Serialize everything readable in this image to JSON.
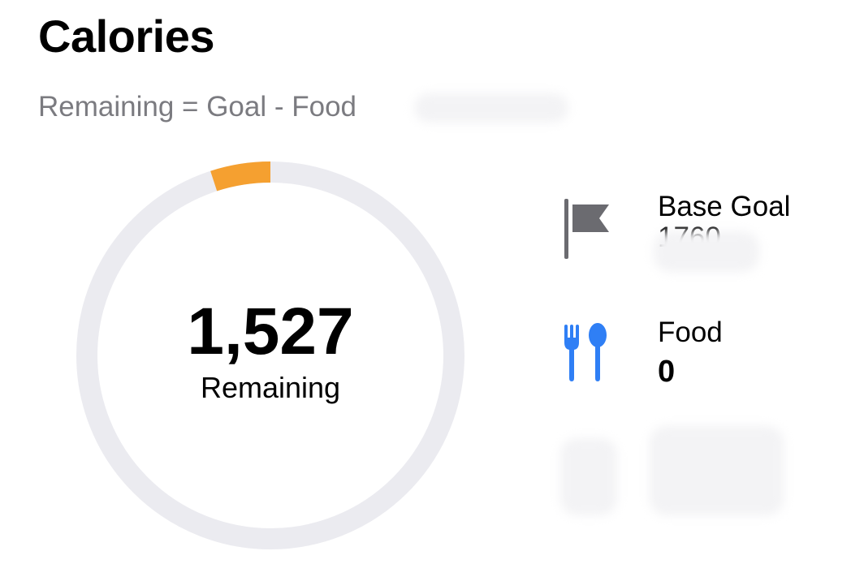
{
  "header": {
    "title": "Calories",
    "formula": "Remaining = Goal - Food"
  },
  "ring": {
    "value": "1,527",
    "label": "Remaining",
    "consumed_fraction": 0.05,
    "track_color": "#ebebf0",
    "progress_color": "#f5a030"
  },
  "stats": [
    {
      "icon": "flag-icon",
      "label": "Base Goal",
      "value": "1760",
      "icon_color": "#6b6b70"
    },
    {
      "icon": "fork-spoon-icon",
      "label": "Food",
      "value": "0",
      "icon_color": "#2f7ff5"
    }
  ]
}
